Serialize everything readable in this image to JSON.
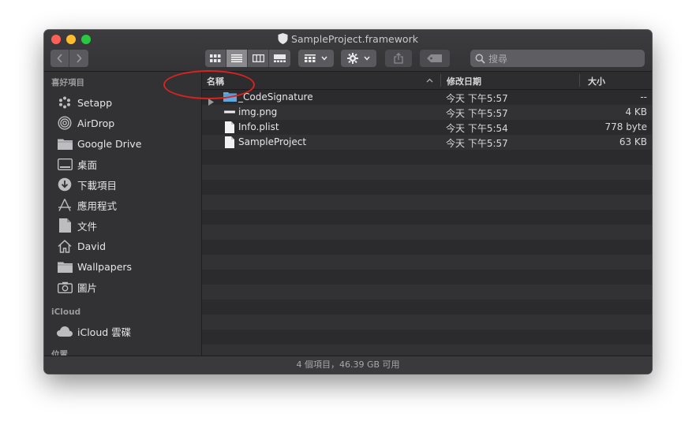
{
  "window": {
    "title": "SampleProject.framework"
  },
  "toolbar": {
    "search_placeholder": "搜尋"
  },
  "sidebar": {
    "favorites_heading": "喜好項目",
    "items": [
      {
        "label": "Setapp",
        "icon": "setapp-icon"
      },
      {
        "label": "AirDrop",
        "icon": "airdrop-icon"
      },
      {
        "label": "Google Drive",
        "icon": "folder-icon"
      },
      {
        "label": "桌面",
        "icon": "desktop-icon"
      },
      {
        "label": "下載項目",
        "icon": "download-icon"
      },
      {
        "label": "應用程式",
        "icon": "applications-icon"
      },
      {
        "label": "文件",
        "icon": "document-icon"
      },
      {
        "label": "David",
        "icon": "home-icon"
      },
      {
        "label": "Wallpapers",
        "icon": "folder-icon"
      },
      {
        "label": "圖片",
        "icon": "camera-icon"
      }
    ],
    "icloud_heading": "iCloud",
    "icloud_items": [
      {
        "label": "iCloud 雲碟",
        "icon": "cloud-icon"
      }
    ],
    "locations_heading_partial": "位置"
  },
  "columns": {
    "name": "名稱",
    "date_modified": "修改日期",
    "size": "大小"
  },
  "files": [
    {
      "name": "_CodeSignature",
      "date": "今天 下午5:57",
      "size": "--",
      "kind": "folder"
    },
    {
      "name": "img.png",
      "date": "今天 下午5:57",
      "size": "4 KB",
      "kind": "image"
    },
    {
      "name": "Info.plist",
      "date": "今天 下午5:54",
      "size": "778 byte",
      "kind": "document"
    },
    {
      "name": "SampleProject",
      "date": "今天 下午5:57",
      "size": "63 KB",
      "kind": "document"
    }
  ],
  "status": {
    "text": "4 個項目，46.39 GB 可用"
  },
  "colors": {
    "annotation": "#d8231f",
    "folder": "#5fa8e0"
  }
}
